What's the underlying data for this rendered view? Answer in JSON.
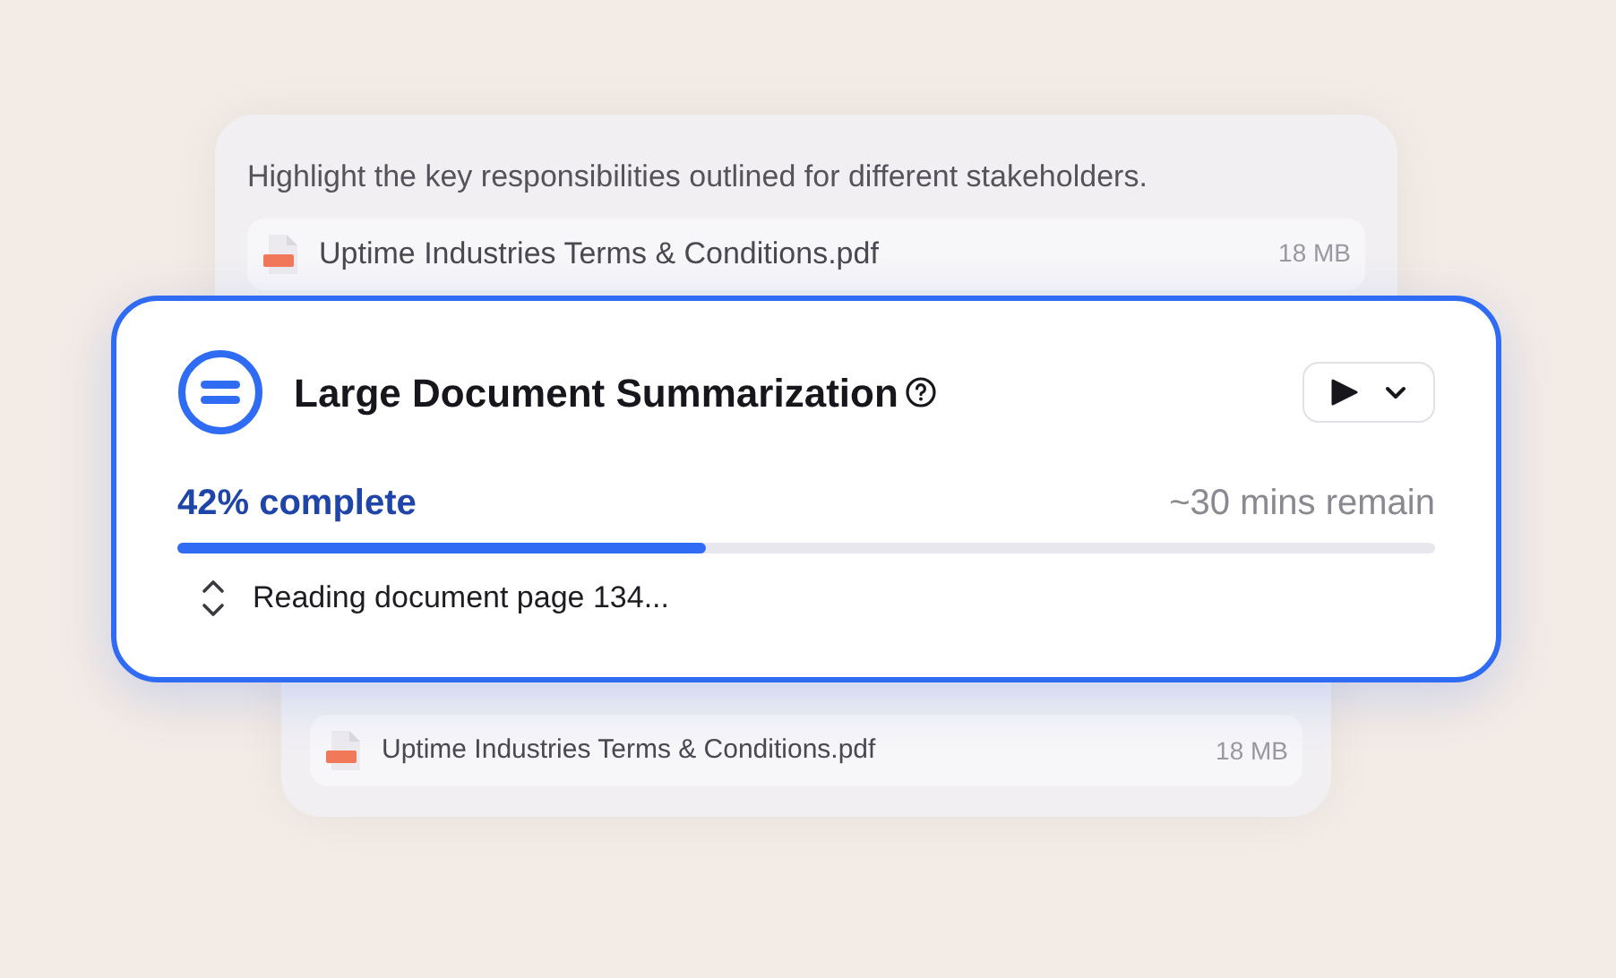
{
  "back_cards": [
    {
      "prompt": "Highlight the key responsibilities outlined for different stakeholders.",
      "file": {
        "name": "Uptime Industries Terms & Conditions.pdf",
        "size": "18 MB"
      }
    },
    {
      "file": {
        "name": "Uptime Industries Terms & Conditions.pdf",
        "size": "18 MB"
      }
    }
  ],
  "task": {
    "title": "Large Document Summarization",
    "progress_label": "42% complete",
    "remaining": "~30 mins remain",
    "level": 0.42,
    "status": "Reading document page 134..."
  }
}
